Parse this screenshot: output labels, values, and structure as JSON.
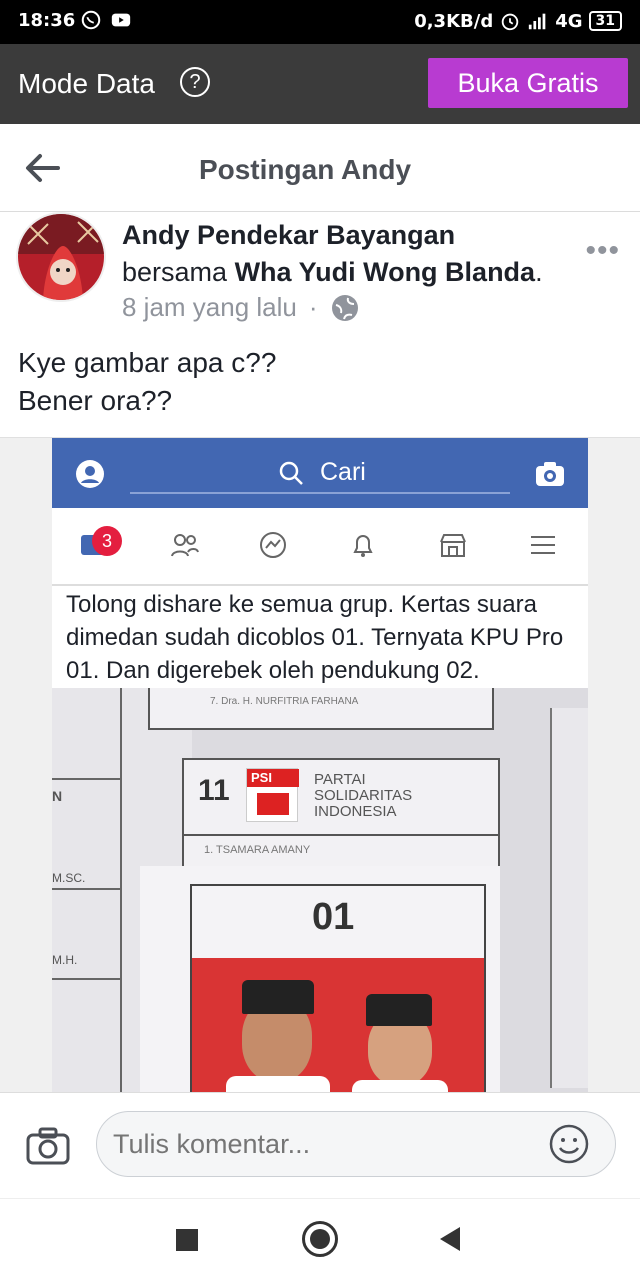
{
  "status_bar": {
    "time": "18:36",
    "network_speed": "0,3KB/d",
    "network_type": "4G",
    "battery": "31",
    "icons": [
      "whatsapp-icon",
      "youtube-icon",
      "alarm-icon",
      "signal-icon"
    ]
  },
  "mode_bar": {
    "title": "Mode Data",
    "help_symbol": "?",
    "cta_label": "Buka Gratis",
    "cta_color": "#b83bd1"
  },
  "header": {
    "title": "Postingan Andy"
  },
  "post": {
    "author": "Andy Pendekar Bayangan",
    "with_prefix": "bersama",
    "tagged": "Wha Yudi Wong Blanda",
    "tagged_suffix": ".",
    "time": "8 jam yang lalu",
    "separator": "·",
    "privacy_icon": "globe-icon",
    "text_lines": [
      "Kye gambar apa c??",
      "Bener ora??"
    ]
  },
  "shared_screenshot": {
    "search_placeholder": "Cari",
    "notification_count": "3",
    "text": "Tolong dishare ke semua grup. Kertas suara dimedan sudah dicoblos 01. Ternyata KPU Pro 01. Dan digerebek oleh pendukung 02.",
    "ballot": {
      "party_number": "11",
      "party_logo_text": "PSI",
      "party_name_lines": [
        "PARTAI",
        "SOLIDARITAS",
        "INDONESIA"
      ],
      "candidate_small": "1. TSAMARA AMANY",
      "top_small": "7. Dra. H. NURFITRIA FARHANA",
      "left_labels": [
        "N",
        "M.SC.",
        "M.H."
      ],
      "pair_number": "01"
    }
  },
  "comment_bar": {
    "placeholder": "Tulis komentar..."
  }
}
